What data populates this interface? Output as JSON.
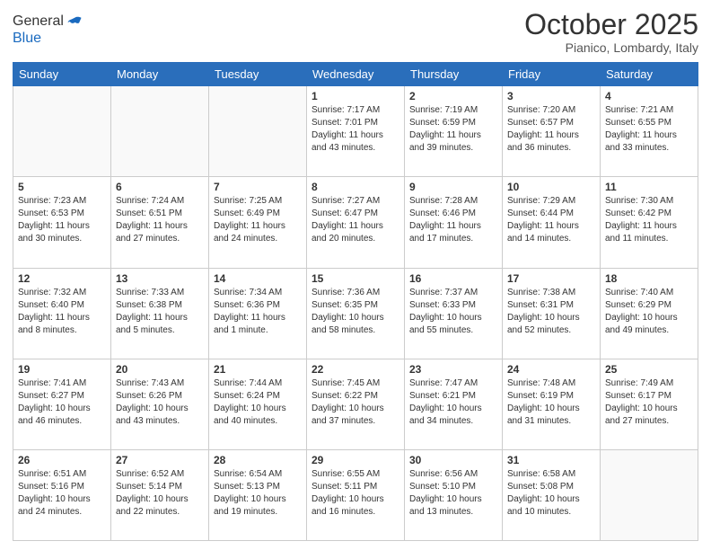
{
  "logo": {
    "line1": "General",
    "line2": "Blue"
  },
  "header": {
    "month": "October 2025",
    "location": "Pianico, Lombardy, Italy"
  },
  "weekdays": [
    "Sunday",
    "Monday",
    "Tuesday",
    "Wednesday",
    "Thursday",
    "Friday",
    "Saturday"
  ],
  "weeks": [
    [
      {
        "day": "",
        "info": ""
      },
      {
        "day": "",
        "info": ""
      },
      {
        "day": "",
        "info": ""
      },
      {
        "day": "1",
        "info": "Sunrise: 7:17 AM\nSunset: 7:01 PM\nDaylight: 11 hours\nand 43 minutes."
      },
      {
        "day": "2",
        "info": "Sunrise: 7:19 AM\nSunset: 6:59 PM\nDaylight: 11 hours\nand 39 minutes."
      },
      {
        "day": "3",
        "info": "Sunrise: 7:20 AM\nSunset: 6:57 PM\nDaylight: 11 hours\nand 36 minutes."
      },
      {
        "day": "4",
        "info": "Sunrise: 7:21 AM\nSunset: 6:55 PM\nDaylight: 11 hours\nand 33 minutes."
      }
    ],
    [
      {
        "day": "5",
        "info": "Sunrise: 7:23 AM\nSunset: 6:53 PM\nDaylight: 11 hours\nand 30 minutes."
      },
      {
        "day": "6",
        "info": "Sunrise: 7:24 AM\nSunset: 6:51 PM\nDaylight: 11 hours\nand 27 minutes."
      },
      {
        "day": "7",
        "info": "Sunrise: 7:25 AM\nSunset: 6:49 PM\nDaylight: 11 hours\nand 24 minutes."
      },
      {
        "day": "8",
        "info": "Sunrise: 7:27 AM\nSunset: 6:47 PM\nDaylight: 11 hours\nand 20 minutes."
      },
      {
        "day": "9",
        "info": "Sunrise: 7:28 AM\nSunset: 6:46 PM\nDaylight: 11 hours\nand 17 minutes."
      },
      {
        "day": "10",
        "info": "Sunrise: 7:29 AM\nSunset: 6:44 PM\nDaylight: 11 hours\nand 14 minutes."
      },
      {
        "day": "11",
        "info": "Sunrise: 7:30 AM\nSunset: 6:42 PM\nDaylight: 11 hours\nand 11 minutes."
      }
    ],
    [
      {
        "day": "12",
        "info": "Sunrise: 7:32 AM\nSunset: 6:40 PM\nDaylight: 11 hours\nand 8 minutes."
      },
      {
        "day": "13",
        "info": "Sunrise: 7:33 AM\nSunset: 6:38 PM\nDaylight: 11 hours\nand 5 minutes."
      },
      {
        "day": "14",
        "info": "Sunrise: 7:34 AM\nSunset: 6:36 PM\nDaylight: 11 hours\nand 1 minute."
      },
      {
        "day": "15",
        "info": "Sunrise: 7:36 AM\nSunset: 6:35 PM\nDaylight: 10 hours\nand 58 minutes."
      },
      {
        "day": "16",
        "info": "Sunrise: 7:37 AM\nSunset: 6:33 PM\nDaylight: 10 hours\nand 55 minutes."
      },
      {
        "day": "17",
        "info": "Sunrise: 7:38 AM\nSunset: 6:31 PM\nDaylight: 10 hours\nand 52 minutes."
      },
      {
        "day": "18",
        "info": "Sunrise: 7:40 AM\nSunset: 6:29 PM\nDaylight: 10 hours\nand 49 minutes."
      }
    ],
    [
      {
        "day": "19",
        "info": "Sunrise: 7:41 AM\nSunset: 6:27 PM\nDaylight: 10 hours\nand 46 minutes."
      },
      {
        "day": "20",
        "info": "Sunrise: 7:43 AM\nSunset: 6:26 PM\nDaylight: 10 hours\nand 43 minutes."
      },
      {
        "day": "21",
        "info": "Sunrise: 7:44 AM\nSunset: 6:24 PM\nDaylight: 10 hours\nand 40 minutes."
      },
      {
        "day": "22",
        "info": "Sunrise: 7:45 AM\nSunset: 6:22 PM\nDaylight: 10 hours\nand 37 minutes."
      },
      {
        "day": "23",
        "info": "Sunrise: 7:47 AM\nSunset: 6:21 PM\nDaylight: 10 hours\nand 34 minutes."
      },
      {
        "day": "24",
        "info": "Sunrise: 7:48 AM\nSunset: 6:19 PM\nDaylight: 10 hours\nand 31 minutes."
      },
      {
        "day": "25",
        "info": "Sunrise: 7:49 AM\nSunset: 6:17 PM\nDaylight: 10 hours\nand 27 minutes."
      }
    ],
    [
      {
        "day": "26",
        "info": "Sunrise: 6:51 AM\nSunset: 5:16 PM\nDaylight: 10 hours\nand 24 minutes."
      },
      {
        "day": "27",
        "info": "Sunrise: 6:52 AM\nSunset: 5:14 PM\nDaylight: 10 hours\nand 22 minutes."
      },
      {
        "day": "28",
        "info": "Sunrise: 6:54 AM\nSunset: 5:13 PM\nDaylight: 10 hours\nand 19 minutes."
      },
      {
        "day": "29",
        "info": "Sunrise: 6:55 AM\nSunset: 5:11 PM\nDaylight: 10 hours\nand 16 minutes."
      },
      {
        "day": "30",
        "info": "Sunrise: 6:56 AM\nSunset: 5:10 PM\nDaylight: 10 hours\nand 13 minutes."
      },
      {
        "day": "31",
        "info": "Sunrise: 6:58 AM\nSunset: 5:08 PM\nDaylight: 10 hours\nand 10 minutes."
      },
      {
        "day": "",
        "info": ""
      }
    ]
  ]
}
